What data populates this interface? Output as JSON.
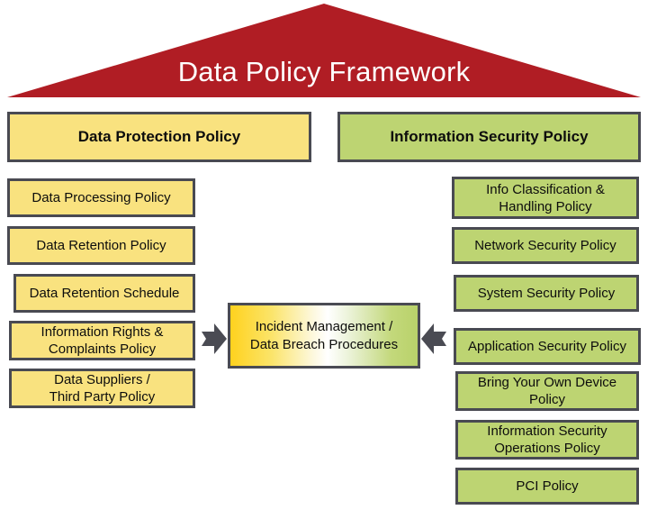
{
  "title": "Data Policy Framework",
  "colors": {
    "roof_red": "#b01d24",
    "yellow": "#f9e27f",
    "green": "#bdd472",
    "border_gray": "#494a52",
    "arrow_gray": "#4a4b53",
    "title_text": "#ffffff",
    "box_text": "#0d0d0d"
  },
  "left_column": {
    "header": "Data Protection Policy",
    "items": [
      {
        "line1": "Data Processing Policy",
        "line2": ""
      },
      {
        "line1": "Data Retention Policy",
        "line2": ""
      },
      {
        "line1": "Data Retention Schedule",
        "line2": ""
      },
      {
        "line1": "Information Rights &",
        "line2": "Complaints Policy"
      },
      {
        "line1": "Data Suppliers /",
        "line2": "Third Party Policy"
      }
    ]
  },
  "right_column": {
    "header": "Information Security Policy",
    "items": [
      {
        "line1": "Info Classification &",
        "line2": "Handling Policy"
      },
      {
        "line1": "Network Security Policy",
        "line2": ""
      },
      {
        "line1": "System Security Policy",
        "line2": ""
      },
      {
        "line1": "Application Security Policy",
        "line2": ""
      },
      {
        "line1": "Bring Your Own Device",
        "line2": "Policy"
      },
      {
        "line1": "Information Security",
        "line2": "Operations Policy"
      },
      {
        "line1": "PCI Policy",
        "line2": ""
      }
    ]
  },
  "center": {
    "line1": "Incident Management /",
    "line2": "Data Breach Procedures",
    "left_arrow_icon": "arrow-right-icon",
    "right_arrow_icon": "arrow-left-icon"
  }
}
